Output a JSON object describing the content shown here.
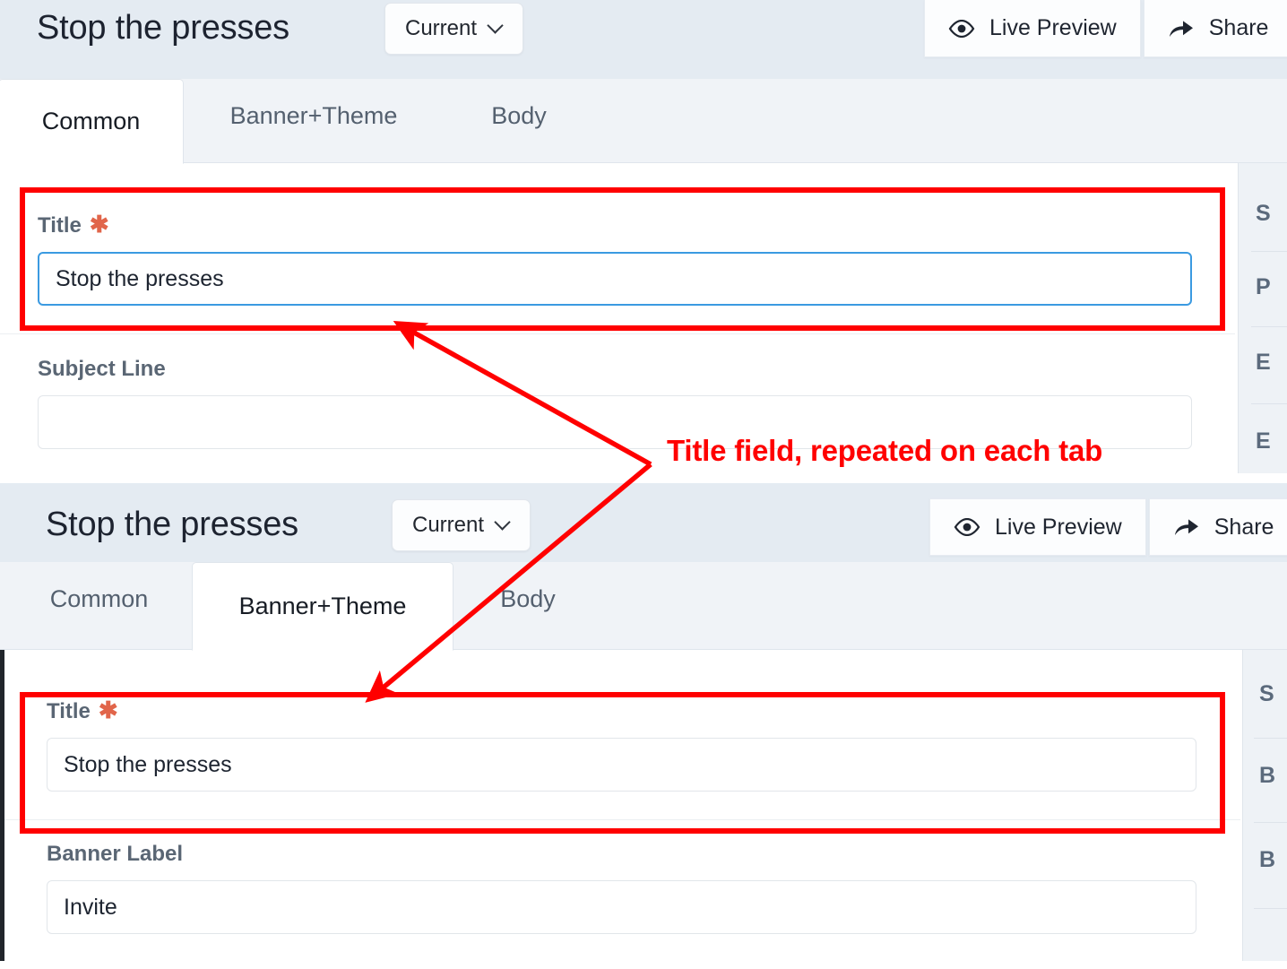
{
  "panels": [
    {
      "id": "panel-common",
      "header": {
        "title": "Stop the presses",
        "version_button": {
          "label": "Current",
          "icon": "chevron-down-icon"
        },
        "actions": [
          {
            "label": "Live Preview",
            "icon": "eye-icon"
          },
          {
            "label": "Share",
            "icon": "share-arrow-icon"
          }
        ]
      },
      "tabs": [
        {
          "label": "Common",
          "active": true
        },
        {
          "label": "Banner+Theme",
          "active": false
        },
        {
          "label": "Body",
          "active": false
        }
      ],
      "fields": [
        {
          "label": "Title",
          "required_marker": "✱",
          "value": "Stop the presses",
          "focused": true
        },
        {
          "label": "Subject Line",
          "required_marker": "",
          "value": "",
          "focused": false
        }
      ],
      "rail_labels": [
        "S",
        "P",
        "E",
        "E"
      ]
    },
    {
      "id": "panel-banner-theme",
      "header": {
        "title": "Stop the presses",
        "version_button": {
          "label": "Current",
          "icon": "chevron-down-icon"
        },
        "actions": [
          {
            "label": "Live Preview",
            "icon": "eye-icon"
          },
          {
            "label": "Share",
            "icon": "share-arrow-icon"
          }
        ]
      },
      "tabs": [
        {
          "label": "Common",
          "active": false
        },
        {
          "label": "Banner+Theme",
          "active": true
        },
        {
          "label": "Body",
          "active": false
        }
      ],
      "fields": [
        {
          "label": "Title",
          "required_marker": "✱",
          "value": "Stop the presses",
          "focused": false
        },
        {
          "label": "Banner Label",
          "required_marker": "",
          "value": "Invite",
          "focused": false
        }
      ],
      "rail_labels": [
        "S",
        "B",
        "B"
      ]
    }
  ],
  "annotation": {
    "text": "Title field, repeated on each tab",
    "color": "#ff0000"
  }
}
